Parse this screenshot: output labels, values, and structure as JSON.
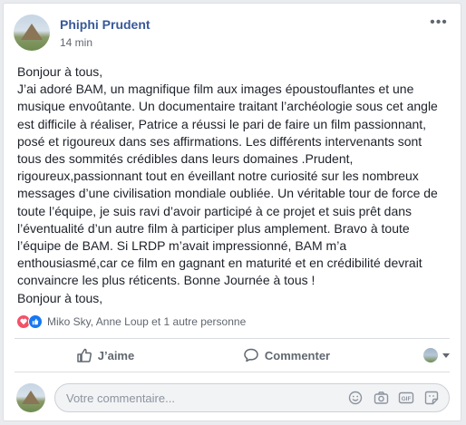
{
  "post": {
    "author": "Phiphi Prudent",
    "time": "14 min",
    "paragraphs": [
      "Bonjour à tous,",
      "J’ai adoré BAM, un magnifique film aux images époustouflantes et une musique envoûtante. Un documentaire traitant l’archéologie sous cet angle est difficile à réaliser, Patrice a réussi le pari de faire un film passionnant, posé et rigoureux dans ses affirmations. Les différents intervenants sont tous des sommités crédibles dans leurs domaines .Prudent, rigoureux,passionnant tout en éveillant notre curiosité sur les nombreux messages d’une civilisation mondiale oubliée. Un véritable tour de force de toute l’équipe, je suis ravi d’avoir participé à ce projet et suis prêt dans l’éventualité d’un autre film à participer plus amplement. Bravo à toute l’équipe de BAM. Si LRDP m’avait impressionné, BAM m’a enthousiasmé,car ce film en gagnant en maturité et en crédibilité devrait convaincre les plus réticents. Bonne Journée à tous !",
      "Bonjour à tous,"
    ]
  },
  "reactions": {
    "text": "Miko Sky, Anne Loup et 1 autre personne",
    "icons": [
      "love-icon",
      "like-icon"
    ]
  },
  "actions": {
    "like_label": "J’aime",
    "comment_label": "Commenter"
  },
  "comment_box": {
    "placeholder": "Votre commentaire..."
  },
  "colors": {
    "author": "#385898",
    "love": "#f25268",
    "like": "#1877f2",
    "muted": "#606770"
  }
}
